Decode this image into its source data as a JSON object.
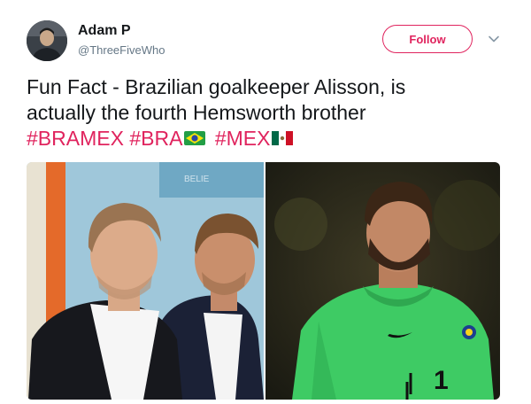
{
  "author": {
    "name": "Adam P",
    "handle": "@ThreeFiveWho",
    "avatar_icon": "user-avatar"
  },
  "header": {
    "follow_label": "Follow",
    "menu_icon": "chevron-down-icon"
  },
  "tweet": {
    "line1": "Fun Fact - Brazilian goalkeeper Alisson, is",
    "line2": "actually the fourth Hemsworth brother",
    "hashtags": [
      "#BRAMEX",
      "#BRA",
      "#MEX"
    ],
    "flags": [
      "brazil-flag-icon",
      "mexico-flag-icon"
    ]
  },
  "media": {
    "left_photo": "two men in suits at a premiere",
    "right_photo": "goalkeeper in green jersey",
    "jersey_number": "1"
  },
  "colors": {
    "accent": "#e0245e",
    "text": "#14171a",
    "secondary": "#657786"
  }
}
